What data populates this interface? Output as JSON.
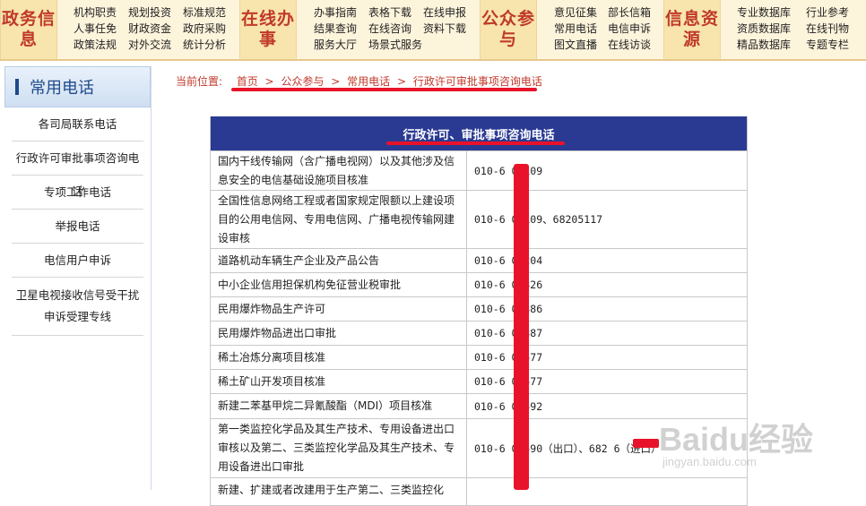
{
  "topnav": {
    "sections": [
      {
        "title": "政务信息",
        "links": [
          [
            "机构职责",
            "规划投资",
            "标准规范"
          ],
          [
            "人事任免",
            "财政资金",
            "政府采购"
          ],
          [
            "政策法规",
            "对外交流",
            "统计分析"
          ]
        ]
      },
      {
        "title": "在线办事",
        "links": [
          [
            "办事指南",
            "表格下载",
            "在线申报"
          ],
          [
            "结果查询",
            "在线咨询",
            "资料下载"
          ],
          [
            "服务大厅",
            "场景式服务",
            ""
          ]
        ]
      },
      {
        "title": "公众参与",
        "links": [
          [
            "意见征集",
            "部长信箱"
          ],
          [
            "常用电话",
            "电信申诉"
          ],
          [
            "图文直播",
            "在线访谈"
          ]
        ]
      },
      {
        "title": "信息资源",
        "links": [
          [
            "专业数据库",
            "行业参考"
          ],
          [
            "资质数据库",
            "在线刊物"
          ],
          [
            "精品数据库",
            "专题专栏"
          ]
        ]
      }
    ]
  },
  "sidebar": {
    "title": "常用电话",
    "items": [
      "各司局联系电话",
      "行政许可审批事项咨询电话",
      "专项工作电话",
      "举报电话",
      "电信用户申诉",
      "卫星电视接收信号受干扰申诉受理专线"
    ]
  },
  "breadcrumb": {
    "label": "当前位置:",
    "items": [
      "首页",
      "公众参与",
      "常用电话",
      "行政许可审批事项咨询电话"
    ],
    "sep": ">"
  },
  "table": {
    "title": "行政许可、审批事项咨询电话",
    "rows": [
      {
        "item": "国内干线传输网（含广播电视网）以及其他涉及信息安全的电信基础设施项目核准",
        "phone": "010-6   05109"
      },
      {
        "item": "全国性信息网络工程或者国家规定限额以上建设项目的公用电信网、专用电信网、广播电视传输网建设审核",
        "phone": "010-6   05109、68205117"
      },
      {
        "item": "道路机动车辆生产企业及产品公告",
        "phone": "010-6   05204"
      },
      {
        "item": "中小企业信用担保机构免征营业税审批",
        "phone": "010-6   05326"
      },
      {
        "item": "民用爆炸物品生产许可",
        "phone": "010-6   05386"
      },
      {
        "item": "民用爆炸物品进出口审批",
        "phone": "010-6   05387"
      },
      {
        "item": "稀土冶炼分离项目核准",
        "phone": "010-6   05577"
      },
      {
        "item": "稀土矿山开发项目核准",
        "phone": "010-6   05577"
      },
      {
        "item": "新建二苯基甲烷二异氰酸酯（MDI）项目核准",
        "phone": "010-6   05592"
      },
      {
        "item": "第一类监控化学品及其生产技术、专用设备进出口审核以及第二、三类监控化学品及其生产技术、专用设备进出口审批",
        "phone": "010-6   05590（出口）、682   6（进口）"
      },
      {
        "item": "新建、扩建或者改建用于生产第二、三类监控化",
        "phone": ""
      }
    ]
  },
  "watermark": {
    "logo": "Baidu经验",
    "sub": "jingyan.baidu.com"
  },
  "colors": {
    "accent": "#c0392b",
    "header_blue": "#2a3a93",
    "redact": "#e8132a"
  }
}
